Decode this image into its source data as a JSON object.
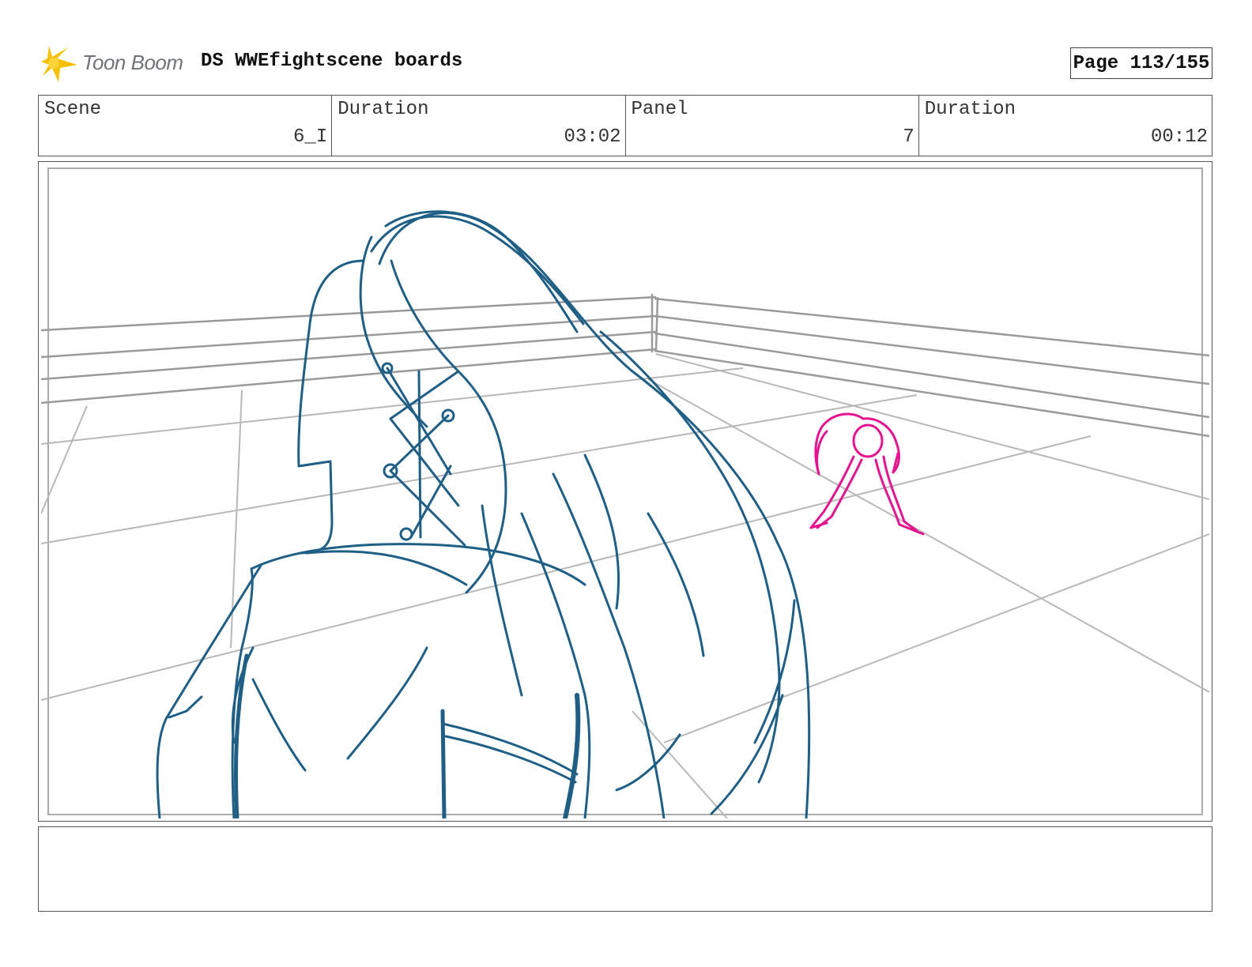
{
  "header": {
    "logo_text": "Toon Boom",
    "project_title": "DS WWEfightscene boards",
    "page": "Page 113/155"
  },
  "info": {
    "scene": {
      "label": "Scene",
      "value": "6_I"
    },
    "scene_duration": {
      "label": "Duration",
      "value": "03:02"
    },
    "panel": {
      "label": "Panel",
      "value": "7"
    },
    "panel_duration": {
      "label": "Duration",
      "value": "00:12"
    }
  },
  "colors": {
    "logo_star": "#f5c000",
    "character_stroke": "#1f5f86",
    "opponent_stroke": "#e6138f",
    "ring_lines": "#9a9a9a"
  },
  "notes": {
    "text": ""
  }
}
